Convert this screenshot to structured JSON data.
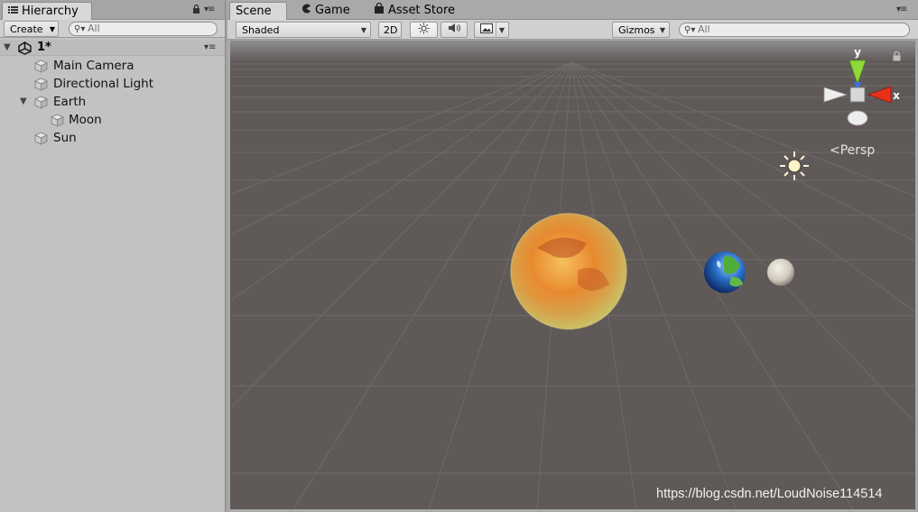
{
  "hierarchy": {
    "tab_label": "Hierarchy",
    "create_label": "Create",
    "search_placeholder": "All",
    "scene_name": "1*",
    "items": [
      {
        "label": "Main Camera"
      },
      {
        "label": "Directional Light"
      },
      {
        "label": "Earth"
      },
      {
        "label": "Moon"
      },
      {
        "label": "Sun"
      }
    ]
  },
  "scene_view": {
    "tabs": [
      {
        "label": "Scene"
      },
      {
        "label": "Game"
      },
      {
        "label": "Asset Store"
      }
    ],
    "toolbar": {
      "shading_mode": "Shaded",
      "mode_2d": "2D",
      "gizmos_label": "Gizmos",
      "search_placeholder": "All"
    },
    "gizmo": {
      "y_label": "y",
      "x_label": "x",
      "projection_label": "Persp"
    },
    "watermark": "https://blog.csdn.net/LoudNoise114514"
  },
  "colors": {
    "panel_bg": "#c2c2c2",
    "viewport_bg": "#5f5958",
    "gizmo_x": "#e8301c",
    "gizmo_y": "#8fd83a",
    "gizmo_z": "#3a6fe8"
  }
}
